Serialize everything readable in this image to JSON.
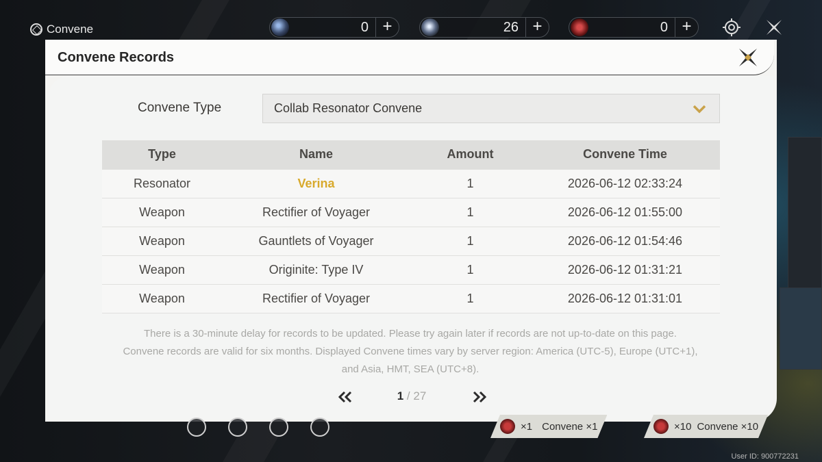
{
  "topbar": {
    "title": "Convene",
    "currencies": [
      {
        "icon": "lustrous-tide-icon",
        "amount": "0"
      },
      {
        "icon": "astrite-icon",
        "amount": "26"
      },
      {
        "icon": "radiant-tide-icon",
        "amount": "0"
      }
    ],
    "plus": "+"
  },
  "modal": {
    "title": "Convene Records",
    "type_label": "Convene Type",
    "type_selected": "Collab Resonator Convene",
    "columns": [
      "Type",
      "Name",
      "Amount",
      "Convene Time"
    ],
    "rows": [
      {
        "type": "Resonator",
        "name": "Verina",
        "amount": "1",
        "time": "2026-06-12 02:33:24",
        "highlight": true
      },
      {
        "type": "Weapon",
        "name": "Rectifier of Voyager",
        "amount": "1",
        "time": "2026-06-12 01:55:00",
        "highlight": false
      },
      {
        "type": "Weapon",
        "name": "Gauntlets of Voyager",
        "amount": "1",
        "time": "2026-06-12 01:54:46",
        "highlight": false
      },
      {
        "type": "Weapon",
        "name": "Originite: Type IV",
        "amount": "1",
        "time": "2026-06-12 01:31:21",
        "highlight": false
      },
      {
        "type": "Weapon",
        "name": "Rectifier of Voyager",
        "amount": "1",
        "time": "2026-06-12 01:31:01",
        "highlight": false
      }
    ],
    "note_line1": "There is a 30-minute delay for records to be updated. Please try again later if records are not up-to-date on this page.",
    "note_line2": "Convene records are valid for six months. Displayed Convene times vary by server region: America (UTC-5), Europe (UTC+1),",
    "note_line3": "and Asia, HMT, SEA (UTC+8).",
    "pager": {
      "current": "1",
      "sep": " / ",
      "total": "27"
    }
  },
  "bottom": {
    "convene_x1": {
      "count": "×1",
      "label": "Convene ×1"
    },
    "convene_x10": {
      "count": "×10",
      "label": "Convene ×10"
    },
    "user_id": "User ID: 900772231"
  },
  "colors": {
    "highlight_gold": "#d8a92b",
    "modal_bg": "#f4f4f2",
    "accent_gold": "#c9a24a"
  }
}
